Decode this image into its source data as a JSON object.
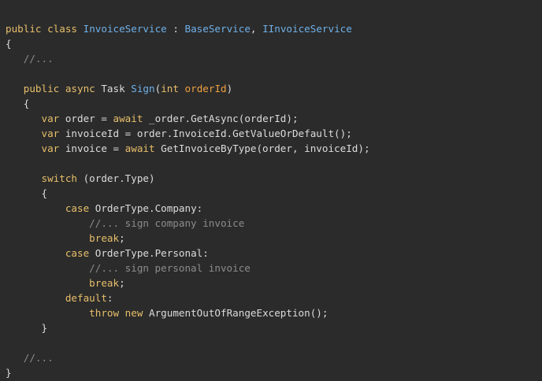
{
  "editor": {
    "background": "#2b2b2b",
    "colors": {
      "kw": "#e8bf6a",
      "type": "#6fb0e8",
      "param": "#f0a040",
      "com": "#8c8c8c",
      "plain": "#dcdcdc"
    },
    "lines": [
      [
        [
          "kw",
          "public"
        ],
        [
          "plain",
          " "
        ],
        [
          "kw",
          "class"
        ],
        [
          "plain",
          " "
        ],
        [
          "type",
          "InvoiceService"
        ],
        [
          "plain",
          " : "
        ],
        [
          "type",
          "BaseService"
        ],
        [
          "plain",
          ", "
        ],
        [
          "type",
          "IInvoiceService"
        ]
      ],
      [
        [
          "plain",
          "{"
        ]
      ],
      [
        [
          "plain",
          "   "
        ],
        [
          "com",
          "//..."
        ]
      ],
      [],
      [
        [
          "plain",
          "   "
        ],
        [
          "kw",
          "public"
        ],
        [
          "plain",
          " "
        ],
        [
          "kw",
          "async"
        ],
        [
          "plain",
          " Task "
        ],
        [
          "type",
          "Sign"
        ],
        [
          "plain",
          "("
        ],
        [
          "kw",
          "int"
        ],
        [
          "plain",
          " "
        ],
        [
          "param",
          "orderId"
        ],
        [
          "plain",
          ")"
        ]
      ],
      [
        [
          "plain",
          "   {"
        ]
      ],
      [
        [
          "plain",
          "      "
        ],
        [
          "kw",
          "var"
        ],
        [
          "plain",
          " order = "
        ],
        [
          "kw",
          "await"
        ],
        [
          "plain",
          " _order.GetAsync(orderId);"
        ]
      ],
      [
        [
          "plain",
          "      "
        ],
        [
          "kw",
          "var"
        ],
        [
          "plain",
          " invoiceId = order.InvoiceId.GetValueOrDefault();"
        ]
      ],
      [
        [
          "plain",
          "      "
        ],
        [
          "kw",
          "var"
        ],
        [
          "plain",
          " invoice = "
        ],
        [
          "kw",
          "await"
        ],
        [
          "plain",
          " GetInvoiceByType(order, invoiceId);"
        ]
      ],
      [],
      [
        [
          "plain",
          "      "
        ],
        [
          "kw",
          "switch"
        ],
        [
          "plain",
          " (order.Type)"
        ]
      ],
      [
        [
          "plain",
          "      {"
        ]
      ],
      [
        [
          "plain",
          "          "
        ],
        [
          "kw",
          "case"
        ],
        [
          "plain",
          " OrderType.Company:"
        ]
      ],
      [
        [
          "plain",
          "              "
        ],
        [
          "com",
          "//... sign company invoice"
        ]
      ],
      [
        [
          "plain",
          "              "
        ],
        [
          "kw",
          "break"
        ],
        [
          "plain",
          ";"
        ]
      ],
      [
        [
          "plain",
          "          "
        ],
        [
          "kw",
          "case"
        ],
        [
          "plain",
          " OrderType.Personal:"
        ]
      ],
      [
        [
          "plain",
          "              "
        ],
        [
          "com",
          "//... sign personal invoice"
        ]
      ],
      [
        [
          "plain",
          "              "
        ],
        [
          "kw",
          "break"
        ],
        [
          "plain",
          ";"
        ]
      ],
      [
        [
          "plain",
          "          "
        ],
        [
          "kw",
          "default"
        ],
        [
          "plain",
          ":"
        ]
      ],
      [
        [
          "plain",
          "              "
        ],
        [
          "kw",
          "throw"
        ],
        [
          "plain",
          " "
        ],
        [
          "kw",
          "new"
        ],
        [
          "plain",
          " ArgumentOutOfRangeException();"
        ]
      ],
      [
        [
          "plain",
          "      }"
        ]
      ],
      [],
      [
        [
          "plain",
          "   "
        ],
        [
          "com",
          "//..."
        ]
      ],
      [
        [
          "plain",
          "}"
        ]
      ]
    ]
  }
}
